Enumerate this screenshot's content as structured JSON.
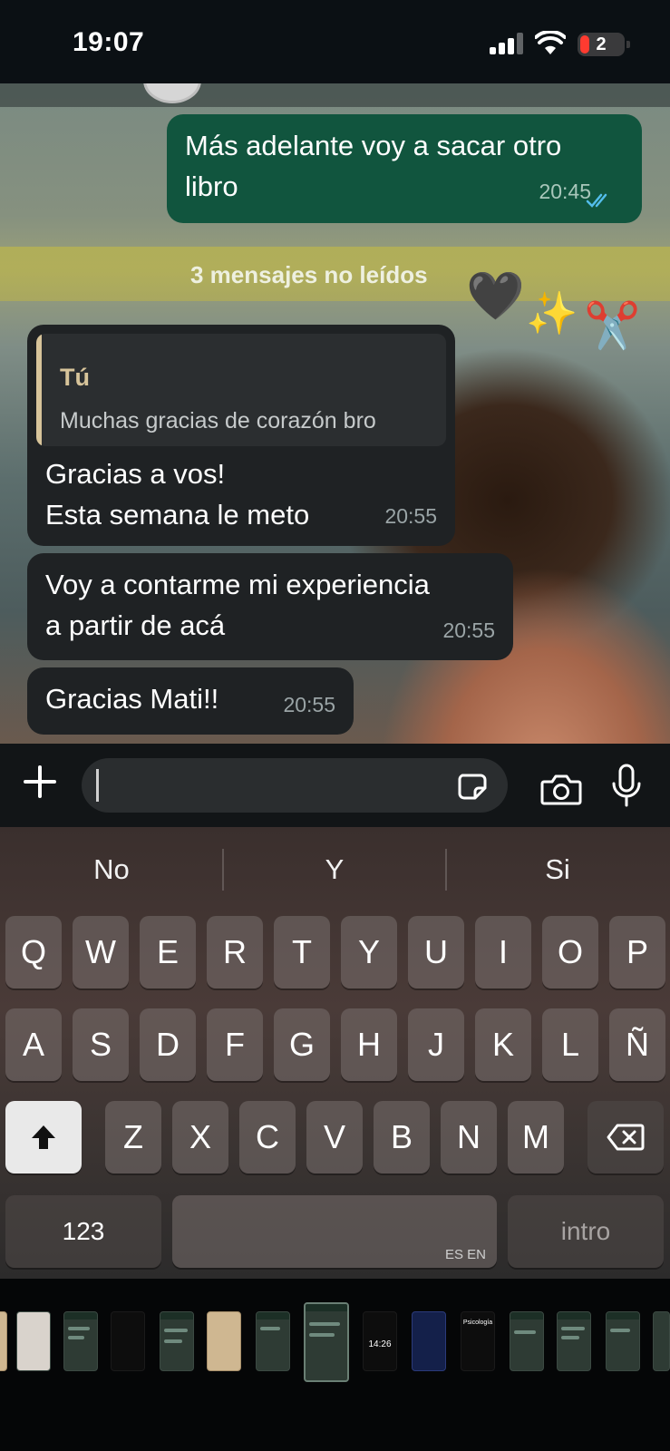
{
  "status_bar": {
    "time": "19:07",
    "battery_label": "2"
  },
  "chat": {
    "unread_banner": "3 mensajes no leídos",
    "messages": [
      {
        "direction": "outgoing",
        "text": "Más adelante voy a sacar otro\nlibro",
        "time": "20:45",
        "read_status": "read-double-check-blue"
      },
      {
        "direction": "incoming",
        "quote": {
          "author": "Tú",
          "text": "Muchas gracias de corazón bro"
        },
        "text": "Gracias a vos!\nEsta semana le meto",
        "time": "20:55"
      },
      {
        "direction": "incoming",
        "text": "Voy a contarme mi experiencia\na partir de acá",
        "time": "20:55"
      },
      {
        "direction": "incoming",
        "text": "Gracias Mati!!",
        "time": "20:55"
      }
    ],
    "overlay_emojis": [
      "🖤",
      "✨",
      "✂️"
    ]
  },
  "composer": {
    "value": "",
    "icons": [
      "plus-icon",
      "sticker-icon",
      "camera-icon",
      "microphone-icon"
    ]
  },
  "keyboard": {
    "suggestions": [
      "No",
      "Y",
      "Si"
    ],
    "row1": [
      "Q",
      "W",
      "E",
      "R",
      "T",
      "Y",
      "U",
      "I",
      "O",
      "P"
    ],
    "row2": [
      "A",
      "S",
      "D",
      "F",
      "G",
      "H",
      "J",
      "K",
      "L",
      "Ñ"
    ],
    "row3": [
      "Z",
      "X",
      "C",
      "V",
      "B",
      "N",
      "M"
    ],
    "numbers_key": "123",
    "space_language": "ES EN",
    "return_key": "intro"
  },
  "thumbnail_strip": {
    "labels": [
      "14:26",
      "Psicología"
    ]
  },
  "colors": {
    "outgoing_bubble": "#11553e",
    "incoming_bubble": "#1f2224",
    "quote_accent": "#d7c49a",
    "read_ticks": "#53bdeb"
  }
}
